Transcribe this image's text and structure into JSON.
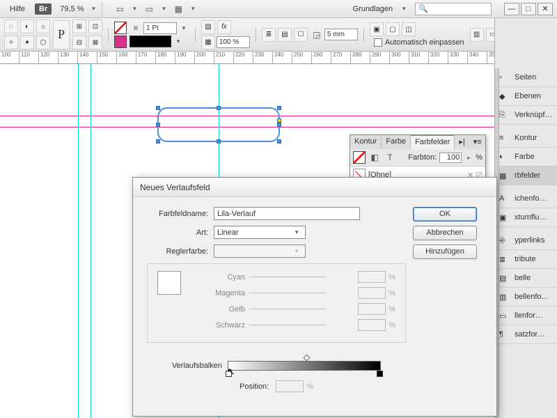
{
  "menubar": {
    "help": "Hilfe",
    "br": "Br",
    "zoom": "79,5 %",
    "workspace": "Grundlagen"
  },
  "toolbar": {
    "stroke_weight": "1 Pt",
    "opacity": "100 %",
    "edge": "5 mm",
    "autofit": "Automatisch einpassen"
  },
  "ruler_start": 100,
  "ruler_step": 10,
  "right_panels": [
    "Seiten",
    "Ebenen",
    "Verknüpf…",
    "Kontur",
    "Farbe",
    "rbfelder",
    "ichenfo…",
    "xtumflu…",
    "yperlinks",
    "tribute",
    "belle",
    "bellenfo…",
    "llenfor…",
    "satzfor…"
  ],
  "swatches_panel": {
    "tabs": [
      "Kontur",
      "Farbe",
      "Farbfelder"
    ],
    "active_tab": 2,
    "farbton_label": "Farbton:",
    "farbton_value": "100",
    "row2": "[Ohne]"
  },
  "dialog": {
    "title": "Neues Verlaufsfeld",
    "name_label": "Farbfeldname:",
    "name_value": "Lila-Verlauf",
    "art_label": "Art:",
    "art_value": "Linear",
    "regler_label": "Reglerfarbe:",
    "channels": [
      "Cyan",
      "Magenta",
      "Gelb",
      "Schwarz"
    ],
    "pct": "%",
    "vb_label": "Verlaufsbalken",
    "pos_label": "Position:",
    "buttons": {
      "ok": "OK",
      "cancel": "Abbrechen",
      "add": "Hinzufügen"
    }
  }
}
